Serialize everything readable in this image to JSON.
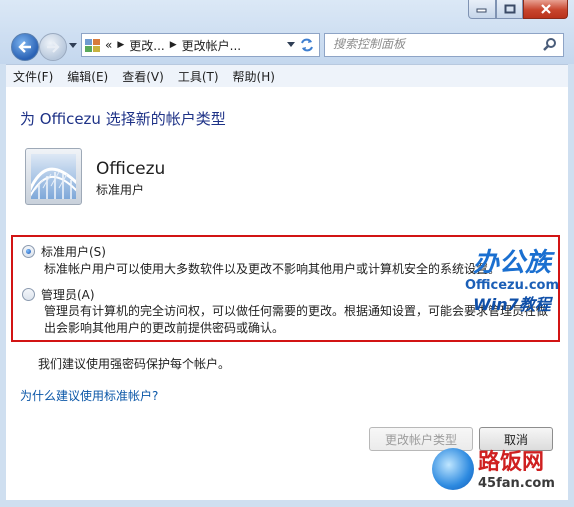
{
  "addressbar": {
    "crumbs": [
      "«",
      "更改...",
      "更改帐户..."
    ],
    "search_placeholder": "搜索控制面板"
  },
  "menu": {
    "items": [
      "文件(F)",
      "编辑(E)",
      "查看(V)",
      "工具(T)",
      "帮助(H)"
    ]
  },
  "page": {
    "heading": "为 Officezu 选择新的帐户类型",
    "user_name": "Officezu",
    "user_type": "标准用户",
    "options": [
      {
        "label": "标准用户(S)",
        "selected": true,
        "description": "标准帐户用户可以使用大多数软件以及更改不影响其他用户或计算机安全的系统设置。"
      },
      {
        "label": "管理员(A)",
        "selected": false,
        "description": "管理员有计算机的完全访问权，可以做任何需要的更改。根据通知设置，可能会要求管理员在做出会影响其他用户的更改前提供密码或确认。"
      }
    ],
    "recommendation": "我们建议使用强密码保护每个帐户。",
    "why_link": "为什么建议使用标准帐户?",
    "change_button": "更改帐户类型",
    "cancel_button": "取消"
  },
  "watermarks": {
    "brand1_title": "办公族",
    "brand1_site": "Officezu.com",
    "brand1_tag": "Win7教程",
    "brand2_title": "路饭网",
    "brand2_site": "45fan.com"
  },
  "colors": {
    "heading": "#1e3287",
    "link": "#0b57a8",
    "highlight_border": "#d21414",
    "close_button": "#c8452d"
  }
}
